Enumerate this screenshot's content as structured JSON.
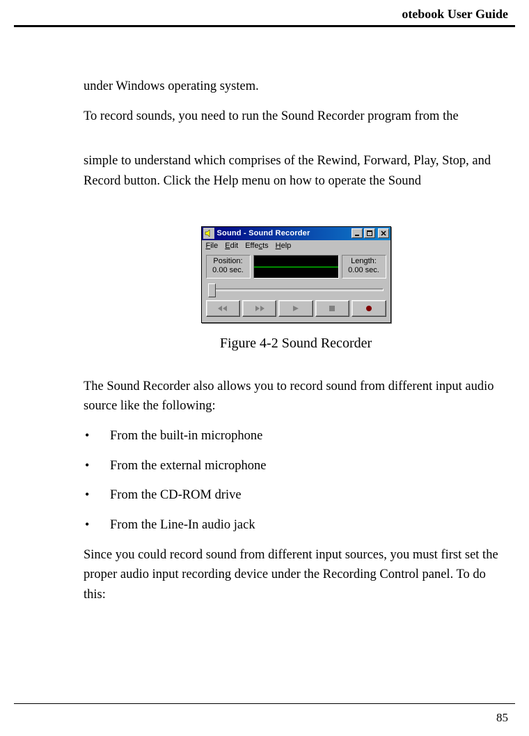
{
  "header": {
    "right": "otebook User Guide"
  },
  "body": {
    "p1": "under Windows operating system.",
    "p2": "To record sounds, you need to run the Sound Recorder program from the",
    "p3": "simple to understand which comprises of the Rewind, Forward, Play, Stop, and Record button. Click the Help menu on how to operate the Sound",
    "p4": "The Sound Recorder also allows you to record sound from different input audio source like the following:",
    "bullets": [
      "From the built-in microphone",
      "From the external microphone",
      "From the CD-ROM drive",
      "From the Line-In audio jack"
    ],
    "p5": "Since you could record sound from different input sources, you must first set the proper audio input recording device under the Recording Control panel. To do this:"
  },
  "figure": {
    "caption": "Figure 4-2    Sound Recorder",
    "window": {
      "title": "Sound - Sound Recorder",
      "menus": {
        "file": "File",
        "edit": "Edit",
        "effects": "Effects",
        "help": "Help"
      },
      "position_label": "Position:",
      "position_value": "0.00 sec.",
      "length_label": "Length:",
      "length_value": "0.00 sec."
    }
  },
  "page_number": "85"
}
